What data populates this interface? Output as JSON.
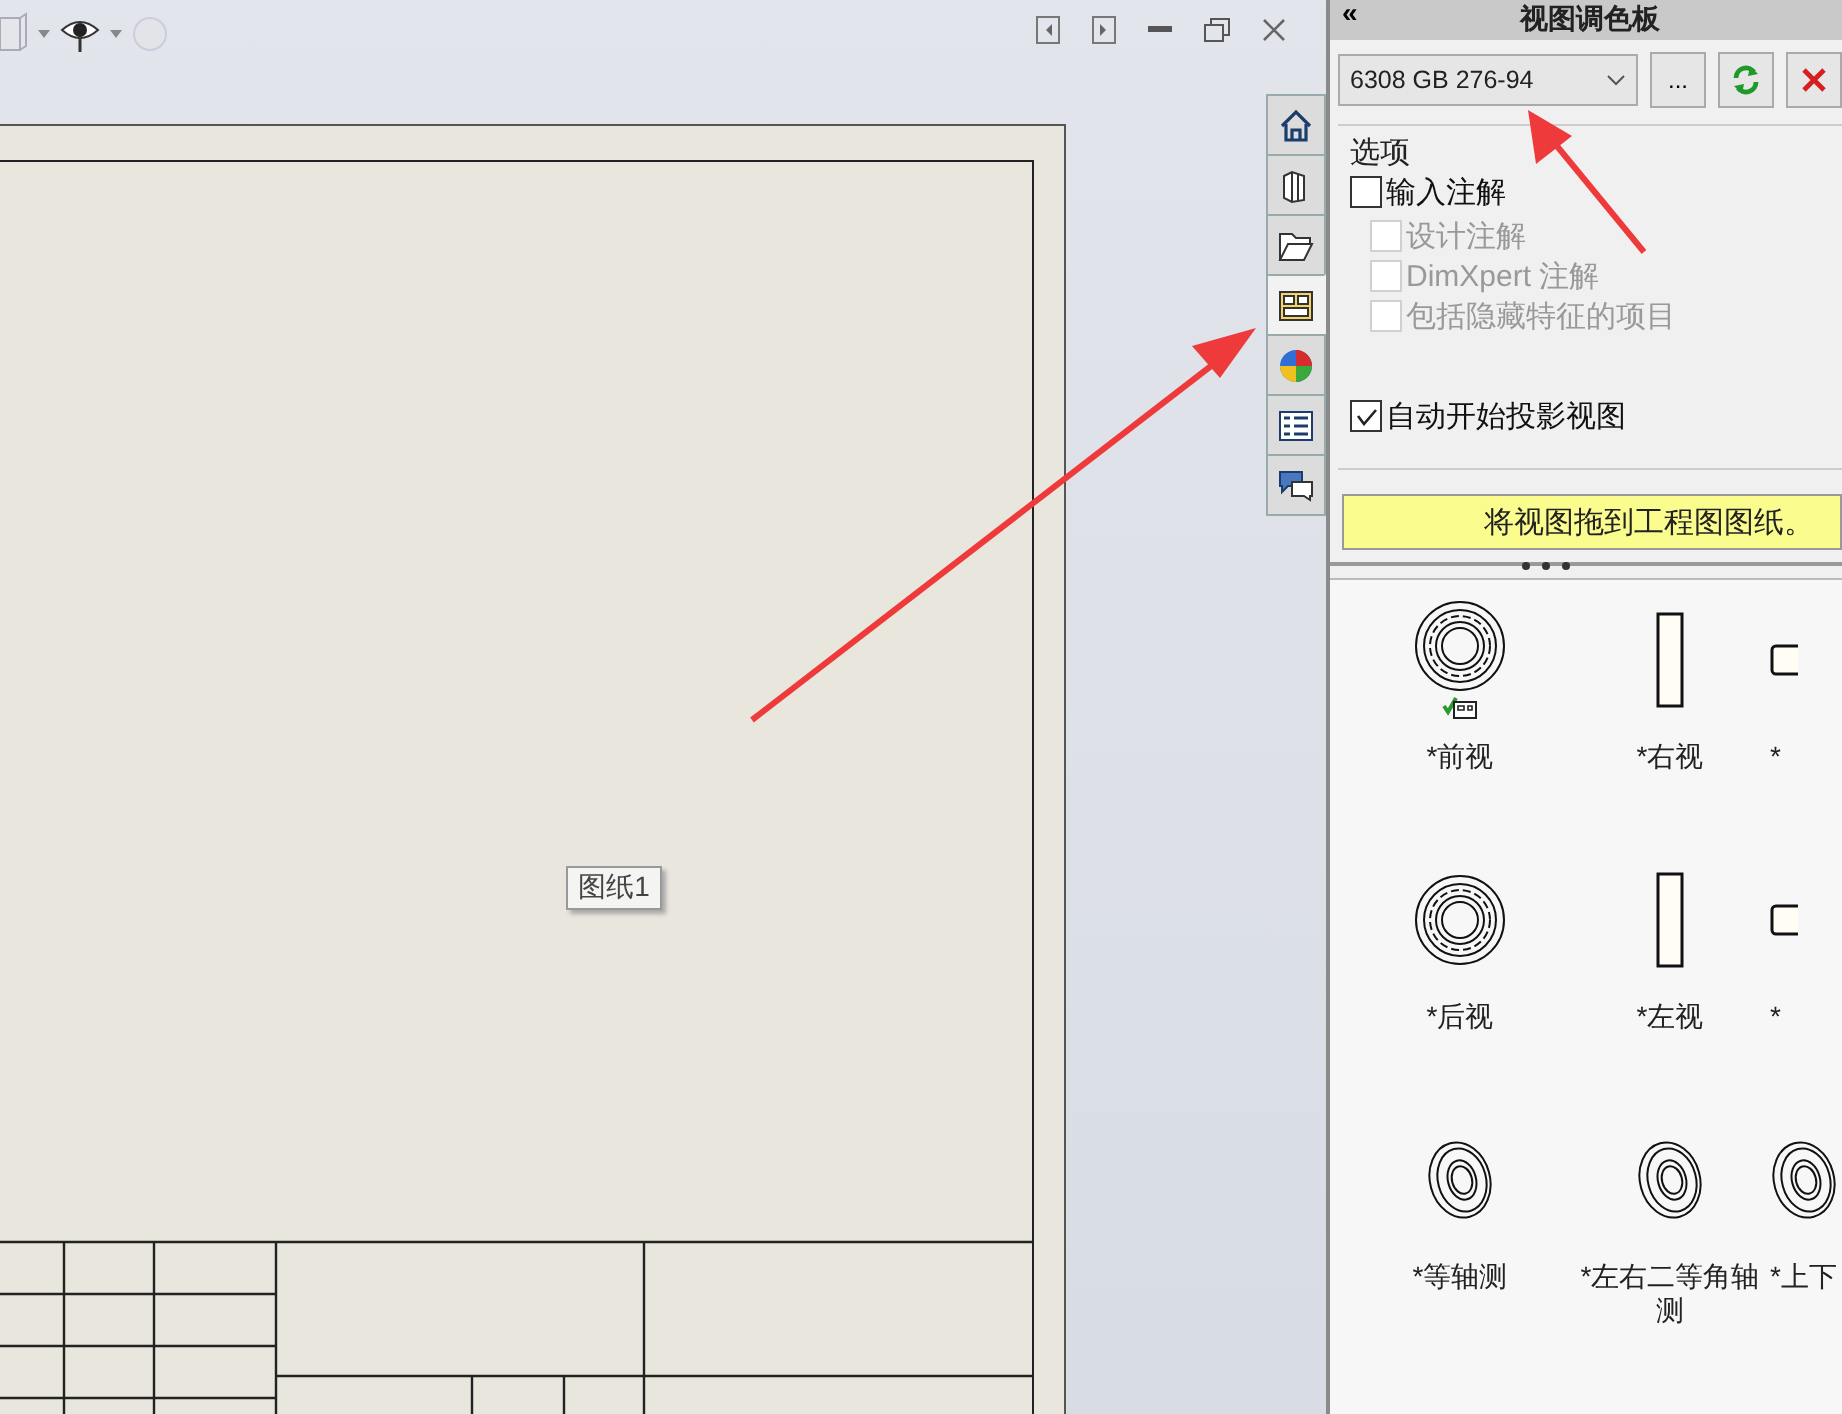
{
  "sheet": {
    "label": "图纸1"
  },
  "side_tabs": [
    {
      "kind": "home",
      "selected": false
    },
    {
      "kind": "parts",
      "selected": false
    },
    {
      "kind": "folder",
      "selected": false
    },
    {
      "kind": "palette",
      "selected": true
    },
    {
      "kind": "appearance",
      "selected": false
    },
    {
      "kind": "properties",
      "selected": false
    },
    {
      "kind": "chat",
      "selected": false
    }
  ],
  "panel": {
    "collapse": "«",
    "title": "视图调色板",
    "dropdown": {
      "value": "6308 GB 276-94"
    },
    "browse_button": "...",
    "options": {
      "title": "选项",
      "items": [
        {
          "label": "输入注解",
          "checked": false,
          "disabled": false,
          "children": [
            {
              "label": "设计注解",
              "checked": false,
              "disabled": true
            },
            {
              "label": "DimXpert 注解",
              "checked": false,
              "disabled": true
            },
            {
              "label": "包括隐藏特征的项目",
              "checked": false,
              "disabled": true
            }
          ]
        },
        {
          "label": "自动开始投影视图",
          "checked": true,
          "disabled": false
        }
      ]
    },
    "banner": "将视图拖到工程图图纸。",
    "views": [
      {
        "label": "*前视",
        "kind": "front",
        "placed": true
      },
      {
        "label": "*右视",
        "kind": "side",
        "placed": false
      },
      {
        "label": "*",
        "kind": "top",
        "placed": false
      },
      {
        "label": "*后视",
        "kind": "front",
        "placed": false
      },
      {
        "label": "*左视",
        "kind": "side",
        "placed": false
      },
      {
        "label": "*",
        "kind": "top",
        "placed": false
      },
      {
        "label": "*等轴测",
        "kind": "iso",
        "placed": false
      },
      {
        "label": "*左右二等角轴测",
        "kind": "iso",
        "placed": false
      },
      {
        "label": "*上下",
        "kind": "iso",
        "placed": false
      }
    ]
  }
}
